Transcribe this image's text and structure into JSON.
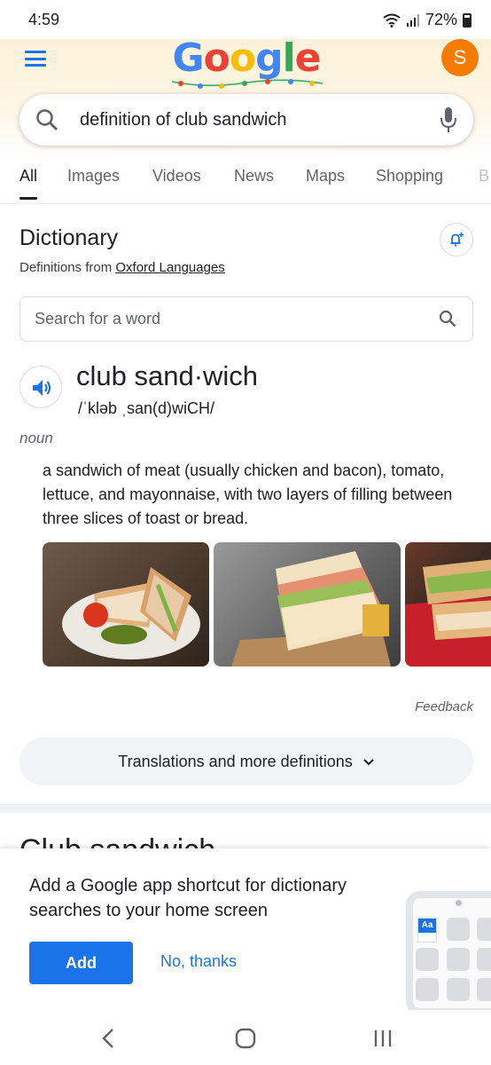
{
  "status_bar": {
    "time": "4:59",
    "battery": "72%"
  },
  "header": {
    "logo_text": [
      "G",
      "o",
      "o",
      "g",
      "l",
      "e"
    ],
    "logo_colors": [
      "#4285f4",
      "#ea4335",
      "#fbbc05",
      "#4285f4",
      "#34a853",
      "#ea4335"
    ],
    "avatar_initial": "S",
    "avatar_color": "#f57c00"
  },
  "search": {
    "query": "definition of club sandwich"
  },
  "tabs": [
    "All",
    "Images",
    "Videos",
    "News",
    "Maps",
    "Shopping",
    "B"
  ],
  "active_tab": "All",
  "dictionary": {
    "title": "Dictionary",
    "source_prefix": "Definitions from ",
    "source_link": "Oxford Languages",
    "word_search_placeholder": "Search for a word",
    "headword": "club sand·wich",
    "phonetic": "/ˈkləb ˌsan(d)wiCH/",
    "part_of_speech": "noun",
    "definition": "a sandwich of meat (usually chicken and bacon), tomato, lettuce, and mayonnaise, with two layers of filling between three slices of toast or bread.",
    "feedback": "Feedback",
    "more_button": "Translations and more definitions"
  },
  "peek_heading": "Club sandwich",
  "bottom_sheet": {
    "message": "Add a Google app shortcut for dictionary searches to your home screen",
    "add_label": "Add",
    "decline_label": "No, thanks",
    "app_icon_text": "Aa"
  },
  "accent_color": "#1a73e8"
}
